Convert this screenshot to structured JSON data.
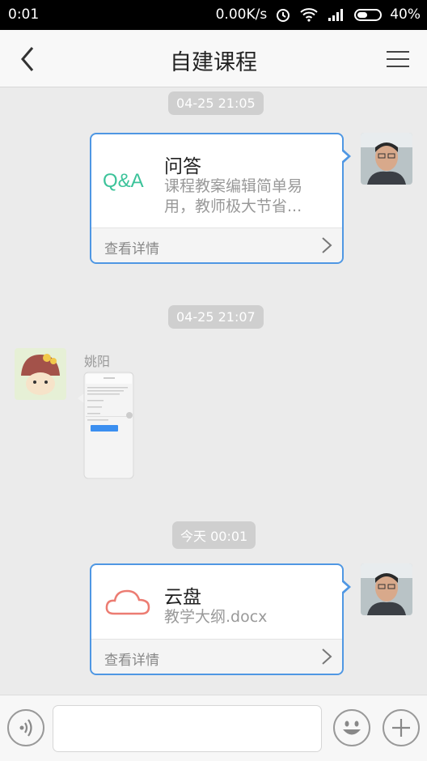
{
  "status_bar": {
    "time": "0:01",
    "speed": "0.00K/s",
    "battery": "40%"
  },
  "header": {
    "title": "自建课程"
  },
  "timestamps": [
    "04-25 21:05",
    "04-25 21:07",
    "今天 00:01"
  ],
  "messages": {
    "qa_card": {
      "icon_text": "Q&A",
      "title": "问答",
      "description_line1": "课程教案编辑简单易",
      "description_line2": "用，教师极大节省...",
      "footer": "查看详情"
    },
    "image_msg": {
      "sender": "姚阳"
    },
    "cloud_card": {
      "title": "云盘",
      "file": "教学大纲.docx",
      "footer": "查看详情"
    }
  },
  "colors": {
    "accent_border": "#4f97e3",
    "qa_green": "#3cc39a",
    "cloud_red": "#ec7c72"
  }
}
